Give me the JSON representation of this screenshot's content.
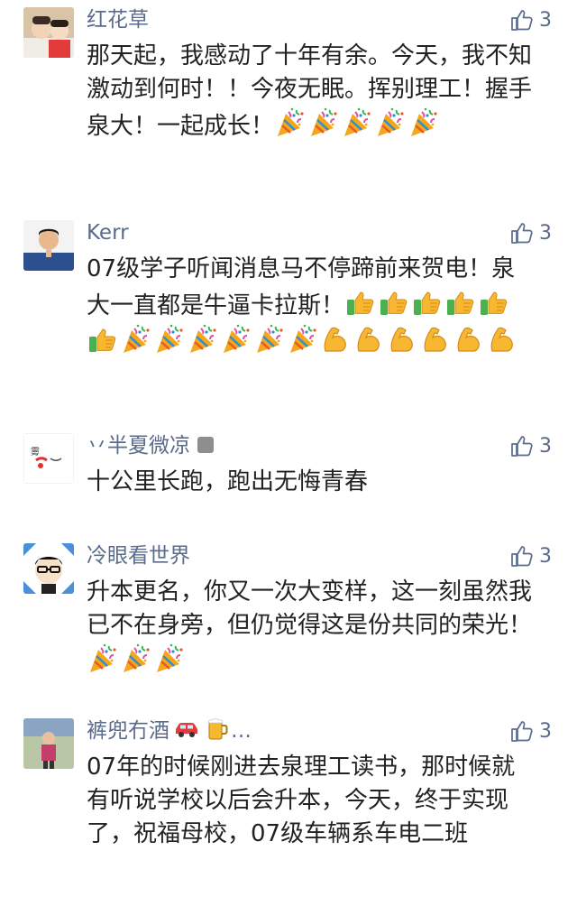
{
  "comments": [
    {
      "name": "红花草",
      "likes": "3",
      "text": "那天起，我感动了十年有余。今天，我不知激动到何时！！今夜无眠。挥别理工！握手泉大！一起成长！",
      "emojis": [
        "party-popper-icon",
        "party-popper-icon",
        "party-popper-icon",
        "party-popper-icon",
        "party-popper-icon"
      ]
    },
    {
      "name": "Kerr",
      "likes": "3",
      "text": "07级学子听闻消息马不停蹄前来贺电！泉大一直都是牛逼卡拉斯！",
      "emojis": [
        "thumbs-up-icon",
        "thumbs-up-icon",
        "thumbs-up-icon",
        "thumbs-up-icon",
        "thumbs-up-icon",
        "thumbs-up-icon",
        "party-popper-icon",
        "party-popper-icon",
        "party-popper-icon",
        "party-popper-icon",
        "party-popper-icon",
        "party-popper-icon",
        "flexed-biceps-icon",
        "flexed-biceps-icon",
        "flexed-biceps-icon",
        "flexed-biceps-icon",
        "flexed-biceps-icon",
        "flexed-biceps-icon"
      ]
    },
    {
      "name": "丷半夏微凉",
      "likes": "3",
      "text": "十公里长跑，跑出无悔青春",
      "emojis": []
    },
    {
      "name": "冷眼看世界",
      "likes": "3",
      "text": "升本更名，你又一次大变样，这一刻虽然我已不在身旁，但仍觉得这是份共同的荣光！",
      "emojis": [
        "party-popper-icon",
        "party-popper-icon",
        "party-popper-icon"
      ]
    },
    {
      "name": "裤兜冇酒",
      "name_suffix": "…",
      "likes": "3",
      "text": "07年的时候刚进去泉理工读书，那时候就有听说学校以后会升本，今天，终于实现了，祝福母校，07级车辆系车电二班",
      "emojis": []
    }
  ],
  "colors": {
    "name": "#5a6b8c",
    "text": "#222222",
    "background": "#ffffff"
  }
}
